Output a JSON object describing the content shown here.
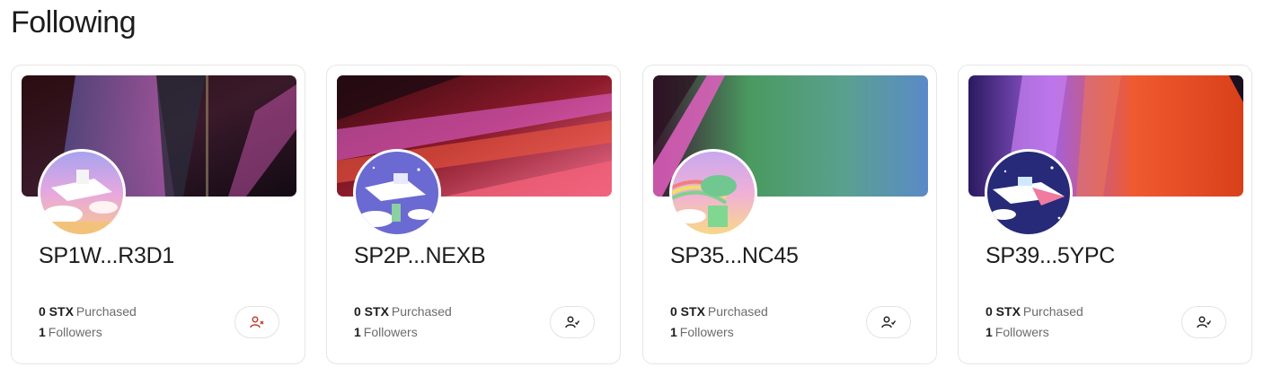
{
  "page": {
    "title": "Following"
  },
  "cards": [
    {
      "name": "SP1W...R3D1",
      "purchased_value": "0 STX",
      "purchased_label": "Purchased",
      "followers_value": "1",
      "followers_label": "Followers",
      "action": "unfollow",
      "action_icon": "user-x-icon",
      "action_color": "#c0392b"
    },
    {
      "name": "SP2P...NEXB",
      "purchased_value": "0 STX",
      "purchased_label": "Purchased",
      "followers_value": "1",
      "followers_label": "Followers",
      "action": "following",
      "action_icon": "user-check-icon",
      "action_color": "#1d1d1d"
    },
    {
      "name": "SP35...NC45",
      "purchased_value": "0 STX",
      "purchased_label": "Purchased",
      "followers_value": "1",
      "followers_label": "Followers",
      "action": "following",
      "action_icon": "user-check-icon",
      "action_color": "#1d1d1d"
    },
    {
      "name": "SP39...5YPC",
      "purchased_value": "0 STX",
      "purchased_label": "Purchased",
      "followers_value": "1",
      "followers_label": "Followers",
      "action": "following",
      "action_icon": "user-check-icon",
      "action_color": "#1d1d1d"
    }
  ]
}
